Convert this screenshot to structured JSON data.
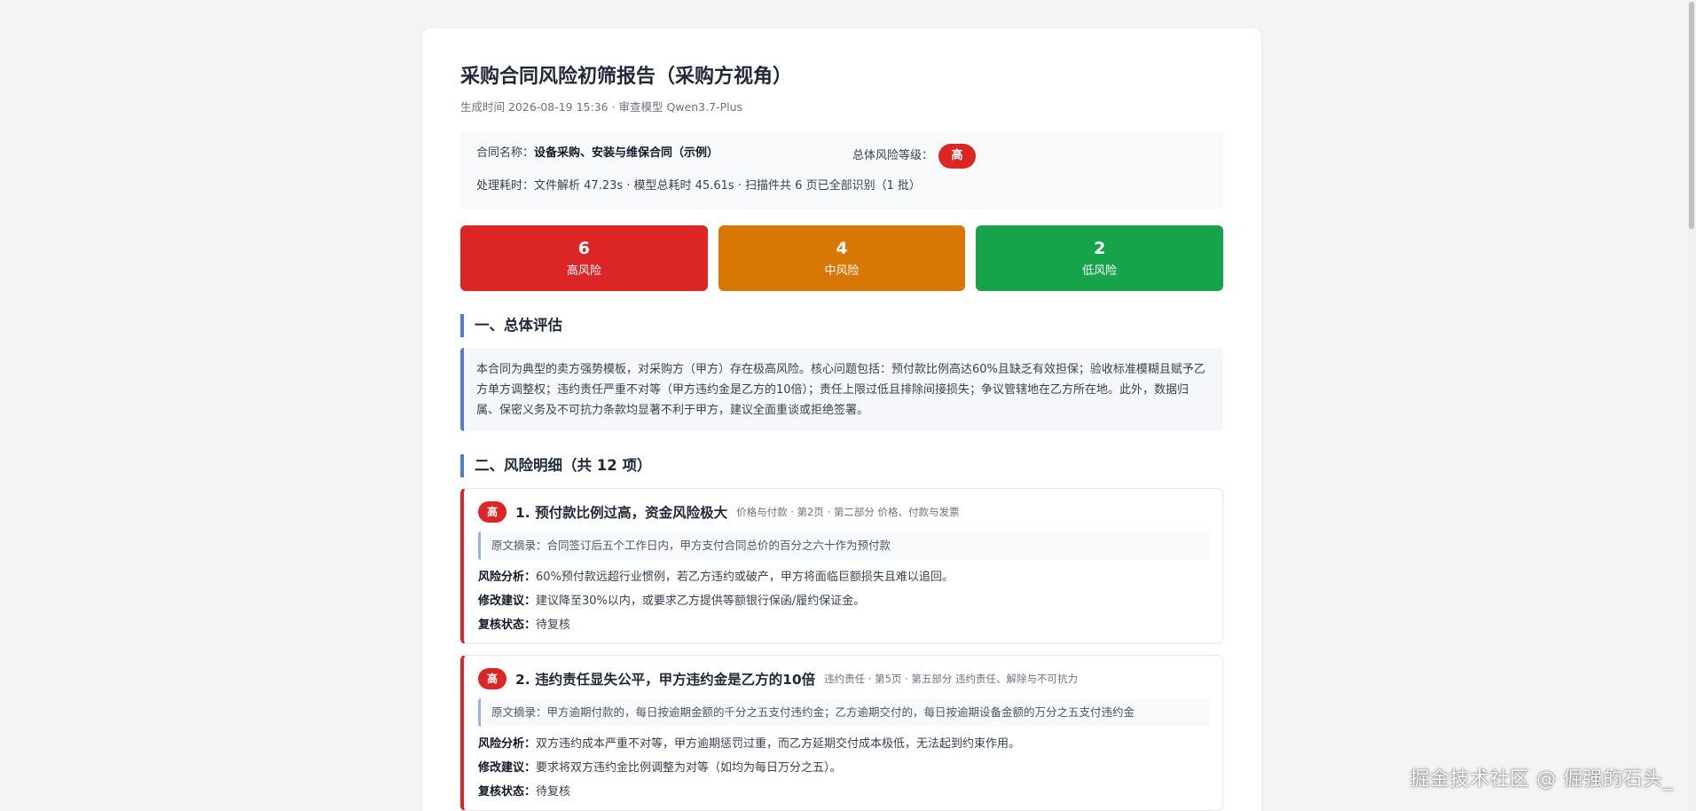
{
  "report": {
    "title": "采购合同风险初筛报告（采购方视角）",
    "subtitle": "生成时间 2026-08-19 15:36 · 审查模型 Qwen3.7-Plus",
    "contract_label": "合同名称：",
    "contract_name": "设备采购、安装与维保合同（示例）",
    "overall_level_label": "总体风险等级：",
    "overall_level": "高",
    "processing_label": "处理耗时：",
    "processing_text": "文件解析 47.23s · 模型总耗时 45.61s · 扫描件共 6 页已全部识别（1 批）"
  },
  "stats": [
    {
      "count": "6",
      "label": "高风险",
      "color": "#dc2626"
    },
    {
      "count": "4",
      "label": "中风险",
      "color": "#d97706"
    },
    {
      "count": "2",
      "label": "低风险",
      "color": "#16a34a"
    }
  ],
  "overview": {
    "title": "一、总体评估",
    "text": "本合同为典型的卖方强势模板，对采购方（甲方）存在极高风险。核心问题包括：预付款比例高达60%且缺乏有效担保；验收标准模糊且赋予乙方单方调整权；违约责任严重不对等（甲方违约金是乙方的10倍）；责任上限过低且排除间接损失；争议管辖地在乙方所在地。此外，数据归属、保密义务及不可抗力条款均显著不利于甲方，建议全面重谈或拒绝签署。"
  },
  "details": {
    "title": "二、风险明细（共 12 项）",
    "items": [
      {
        "badge": "高",
        "title": "1. 预付款比例过高，资金风险极大",
        "tag": "价格与付款 · 第2页 · 第二部分 价格、付款与发票",
        "quote": "原文摘录：合同签订后五个工作日内，甲方支付合同总价的百分之六十作为预付款",
        "analysis_label": "风险分析：",
        "analysis": "60%预付款远超行业惯例，若乙方违约或破产，甲方将面临巨额损失且难以追回。",
        "suggestion_label": "修改建议：",
        "suggestion": "建议降至30%以内，或要求乙方提供等额银行保函/履约保证金。",
        "status_label": "复核状态：",
        "status": "待复核"
      },
      {
        "badge": "高",
        "title": "2. 违约责任显失公平，甲方违约金是乙方的10倍",
        "tag": "违约责任 · 第5页 · 第五部分 违约责任、解除与不可抗力",
        "quote": "原文摘录：甲方逾期付款的，每日按逾期金额的千分之五支付违约金；乙方逾期交付的，每日按逾期设备金额的万分之五支付违约金",
        "analysis_label": "风险分析：",
        "analysis": "双方违约成本严重不对等，甲方逾期惩罚过重，而乙方延期交付成本极低，无法起到约束作用。",
        "suggestion_label": "修改建议：",
        "suggestion": "要求将双方违约金比例调整为对等（如均为每日万分之五）。",
        "status_label": "复核状态：",
        "status": "待复核"
      }
    ]
  },
  "watermark": "掘金技术社区 @ 倔强的石头_"
}
